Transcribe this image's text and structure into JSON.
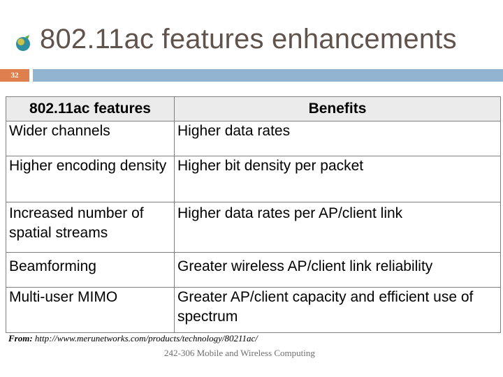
{
  "slide": {
    "title": "802.11ac features enhancements",
    "number": "32",
    "logo_icon": "globe-logo-icon"
  },
  "table": {
    "headers": [
      "802.11ac features",
      "Benefits"
    ],
    "rows": [
      {
        "feature": "Wider channels",
        "benefit": "Higher data rates"
      },
      {
        "feature": "Higher encoding density",
        "benefit": "Higher bit density per packet"
      },
      {
        "feature": "Increased number of spatial streams",
        "benefit": "Higher data rates per AP/client link"
      },
      {
        "feature": "Beamforming",
        "benefit": "Greater wireless AP/client link reliability"
      },
      {
        "feature": "Multi-user MIMO",
        "benefit": "Greater AP/client capacity and efficient use of spectrum"
      }
    ]
  },
  "source": {
    "label": "From:",
    "url": " http://www.merunetworks.com/products/technology/80211ac/"
  },
  "footer": "242-306 Mobile and Wireless Computing",
  "colors": {
    "slide_number_bg": "#df7f4d",
    "bar_bg": "#93b4d1",
    "title_text": "#5f534c",
    "header_bg": "#ebebeb"
  }
}
